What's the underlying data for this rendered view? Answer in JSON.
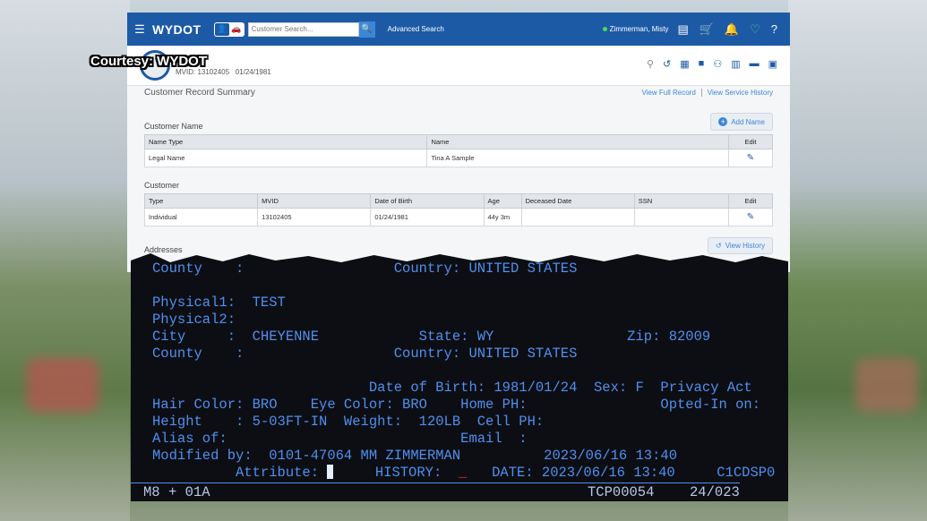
{
  "overlay": {
    "courtesy": "Courtesy: WYDOT"
  },
  "topbar": {
    "logo": "WYDOT",
    "search_placeholder": "Customer Search...",
    "advanced_search": "Advanced Search",
    "user": "Zimmerman, Misty"
  },
  "subbar": {
    "mvid_text": "MVID: 13102405",
    "dob": "01/24/1981"
  },
  "summary": {
    "title": "Customer Record Summary",
    "link_full": "View Full Record",
    "link_history": "View Service History"
  },
  "customer_name": {
    "heading": "Customer Name",
    "add_label": "Add Name",
    "columns": [
      "Name Type",
      "Name",
      "Edit"
    ],
    "rows": [
      [
        "Legal Name",
        "Tina A Sample"
      ]
    ]
  },
  "customer": {
    "heading": "Customer",
    "columns": [
      "Type",
      "MVID",
      "Date of Birth",
      "Age",
      "Deceased Date",
      "SSN",
      "Edit"
    ],
    "rows": [
      [
        "Individual",
        "13102405",
        "01/24/1981",
        "44y 3m",
        "",
        ""
      ]
    ]
  },
  "addresses": {
    "heading": "Addresses",
    "history_label": "View History"
  },
  "terminal": {
    "l0": "County    :                  Country: UNITED STATES",
    "l1": "Physical1:  TEST",
    "l2": "Physical2:",
    "l3": "City     :  CHEYENNE            State: WY                Zip: 82009",
    "l4": "County    :                  Country: UNITED STATES",
    "l5": "                          Date of Birth: 1981/01/24  Sex: F  Privacy Act",
    "l6": "Hair Color: BRO    Eye Color: BRO    Home PH:                Opted-In on:",
    "l7": "Height    : 5-03FT-IN  Weight:  120LB  Cell PH:",
    "l8": "Alias of:                            Email  :",
    "l9": "Modified by:  0101-47064 MM ZIMMERMAN          2023/06/16 13:40",
    "l10a": "          Attribute: ",
    "l10b": "     HISTORY:  ",
    "l10c": "_",
    "l10d": "   DATE: 2023/06/16 13:40     C1CDSP0",
    "s1": "M8",
    "s2": "+ 01A",
    "s3": "TCP00054",
    "s4": "24/023"
  }
}
